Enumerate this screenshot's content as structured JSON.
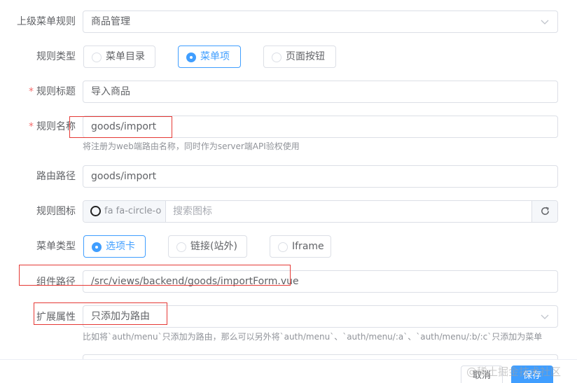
{
  "fields": {
    "parent_menu": {
      "label": "上级菜单规则",
      "value": "商品管理"
    },
    "rule_type": {
      "label": "规则类型",
      "options": [
        "菜单目录",
        "菜单项",
        "页面按钮"
      ],
      "selected": "菜单项"
    },
    "rule_title": {
      "required": "*",
      "label": "规则标题",
      "value": "导入商品"
    },
    "rule_name": {
      "required": "*",
      "label": "规则名称",
      "value": "goods/import",
      "help": "将注册为web端路由名称，同时作为server端API验权使用"
    },
    "route_path": {
      "label": "路由路径",
      "value": "goods/import"
    },
    "rule_icon": {
      "label": "规则图标",
      "icon_name": "fa fa-circle-o",
      "placeholder": "搜索图标",
      "refresh_icon": "refresh-icon"
    },
    "menu_type": {
      "label": "菜单类型",
      "options": [
        "选项卡",
        "链接(站外)",
        "Iframe"
      ],
      "selected": "选项卡"
    },
    "component_path": {
      "label": "组件路径",
      "value": "/src/views/backend/goods/importForm.vue"
    },
    "extend": {
      "label": "扩展属性",
      "value": "只添加为路由",
      "help": "比如将`auth/menu`只添加为路由，那么可以另外将`auth/menu`、`auth/menu/:a`、`auth/menu/:b/:c`只添加为菜单"
    }
  },
  "footer": {
    "cancel_label": "取消",
    "save_label": "保存"
  },
  "watermark": "@稀土掘金技术社区",
  "colors": {
    "primary": "#409eff",
    "required": "#f56c6c",
    "annotation": "#e53935"
  }
}
